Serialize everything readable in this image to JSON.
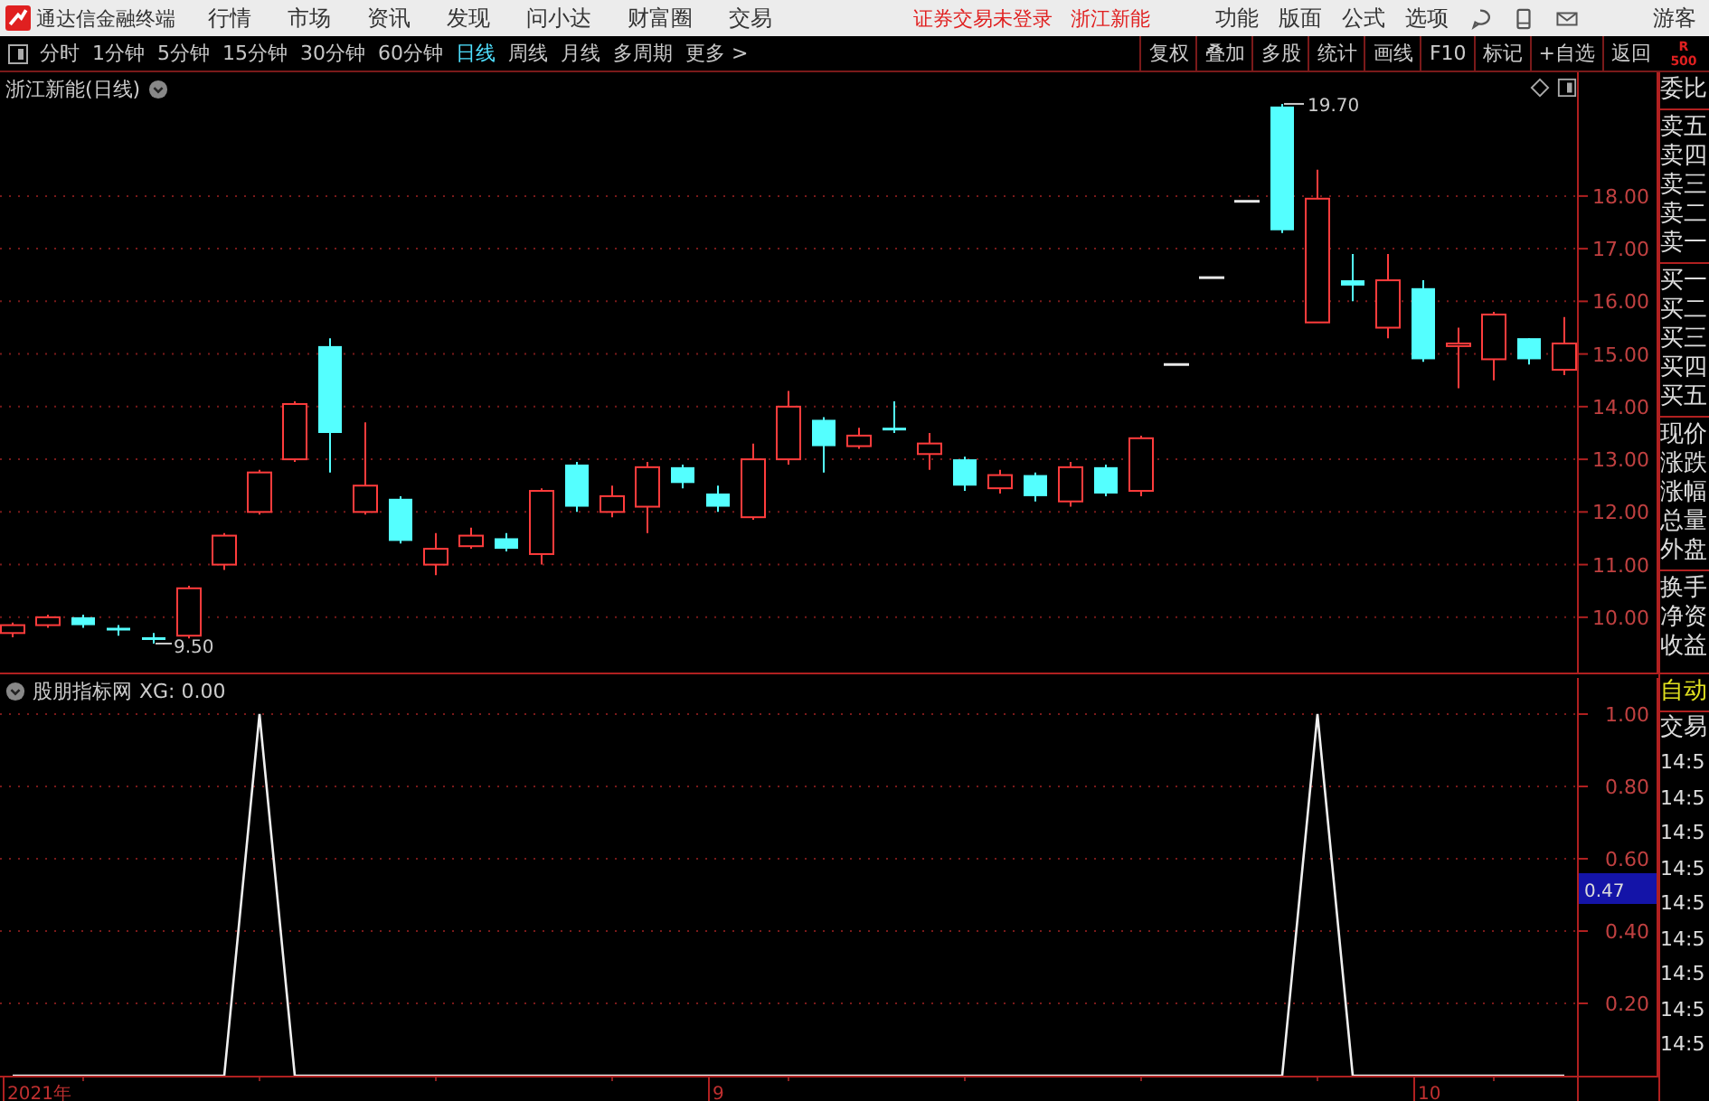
{
  "app": {
    "title": "通达信金融终端"
  },
  "menu": [
    "行情",
    "市场",
    "资讯",
    "发现",
    "问小达",
    "财富圈",
    "交易"
  ],
  "notices": [
    "证券交易未登录",
    "浙江新能"
  ],
  "tools": [
    "功能",
    "版面",
    "公式",
    "选项"
  ],
  "user": "游客",
  "periods": [
    {
      "label": "分时",
      "selected": false
    },
    {
      "label": "1分钟",
      "selected": false
    },
    {
      "label": "5分钟",
      "selected": false
    },
    {
      "label": "15分钟",
      "selected": false
    },
    {
      "label": "30分钟",
      "selected": false
    },
    {
      "label": "60分钟",
      "selected": false
    },
    {
      "label": "日线",
      "selected": true
    },
    {
      "label": "周线",
      "selected": false
    },
    {
      "label": "月线",
      "selected": false
    },
    {
      "label": "多周期",
      "selected": false
    }
  ],
  "more": "更多 >",
  "actions": [
    "复权",
    "叠加",
    "多股",
    "统计",
    "画线",
    "F10",
    "标记",
    "+自选",
    "返回"
  ],
  "level_badge": [
    "R",
    "500"
  ],
  "price_chart": {
    "title": "浙江新能(日线)",
    "high_label": "19.70",
    "low_label": "9.50",
    "chart_data": {
      "type": "candlestick",
      "ohlc": [
        [
          9.7,
          9.9,
          9.62,
          9.85
        ],
        [
          9.85,
          10.05,
          9.8,
          10.0
        ],
        [
          10.0,
          10.05,
          9.8,
          9.85
        ],
        [
          9.8,
          9.85,
          9.65,
          9.75
        ],
        [
          9.62,
          9.7,
          9.5,
          9.6
        ],
        [
          9.65,
          10.6,
          9.6,
          10.55
        ],
        [
          11.0,
          11.6,
          10.9,
          11.55
        ],
        [
          12.0,
          12.8,
          11.95,
          12.75
        ],
        [
          13.0,
          14.1,
          12.95,
          14.05
        ],
        [
          15.15,
          15.3,
          12.75,
          13.5
        ],
        [
          12.0,
          13.7,
          11.95,
          12.5
        ],
        [
          12.25,
          12.3,
          11.4,
          11.45
        ],
        [
          11.0,
          11.6,
          10.8,
          11.3
        ],
        [
          11.35,
          11.7,
          11.3,
          11.55
        ],
        [
          11.5,
          11.6,
          11.25,
          11.3
        ],
        [
          11.2,
          12.45,
          11.0,
          12.4
        ],
        [
          12.9,
          12.95,
          12.0,
          12.1
        ],
        [
          12.0,
          12.5,
          11.9,
          12.3
        ],
        [
          12.1,
          12.95,
          11.6,
          12.85
        ],
        [
          12.85,
          12.9,
          12.45,
          12.55
        ],
        [
          12.35,
          12.5,
          12.0,
          12.1
        ],
        [
          11.9,
          13.3,
          11.85,
          13.0
        ],
        [
          13.0,
          14.3,
          12.9,
          14.0
        ],
        [
          13.75,
          13.8,
          12.75,
          13.25
        ],
        [
          13.25,
          13.6,
          13.2,
          13.45
        ],
        [
          13.6,
          14.1,
          13.5,
          13.55
        ],
        [
          13.1,
          13.5,
          12.8,
          13.3
        ],
        [
          13.0,
          13.05,
          12.4,
          12.5
        ],
        [
          12.45,
          12.8,
          12.35,
          12.7
        ],
        [
          12.7,
          12.75,
          12.2,
          12.3
        ],
        [
          12.2,
          12.95,
          12.1,
          12.85
        ],
        [
          12.85,
          12.9,
          12.3,
          12.35
        ],
        [
          12.4,
          13.45,
          12.3,
          13.4
        ],
        [
          14.8,
          14.8,
          14.8,
          14.8
        ],
        [
          16.45,
          16.45,
          16.45,
          16.45
        ],
        [
          17.9,
          17.9,
          17.9,
          17.9
        ],
        [
          19.7,
          19.75,
          17.3,
          17.35
        ],
        [
          15.6,
          18.5,
          15.6,
          17.95
        ],
        [
          16.4,
          16.9,
          16.0,
          16.3
        ],
        [
          15.5,
          16.9,
          15.3,
          16.4
        ],
        [
          16.25,
          16.4,
          14.85,
          14.9
        ],
        [
          15.15,
          15.5,
          14.35,
          15.2
        ],
        [
          14.9,
          15.8,
          14.5,
          15.75
        ],
        [
          15.3,
          15.3,
          14.8,
          14.9
        ],
        [
          14.7,
          15.7,
          14.6,
          15.2
        ]
      ],
      "ylim": [
        8.95,
        20.35
      ],
      "grid": true,
      "yticks": [
        {
          "value": 18,
          "label": "18.00"
        },
        {
          "value": 17,
          "label": "17.00"
        },
        {
          "value": 16,
          "label": "16.00"
        },
        {
          "value": 15,
          "label": "15.00"
        },
        {
          "value": 14,
          "label": "14.00"
        },
        {
          "value": 13,
          "label": "13.00"
        },
        {
          "value": 12,
          "label": "12.00"
        },
        {
          "value": 11,
          "label": "11.00"
        },
        {
          "value": 10,
          "label": "10.00"
        }
      ]
    }
  },
  "indicator": {
    "name": "股朋指标网",
    "reading": "XG: 0.00",
    "cursor_value": "0.47",
    "chart_data": {
      "type": "line",
      "values": [
        0,
        0,
        0,
        0,
        0,
        0,
        0,
        1,
        0,
        0,
        0,
        0,
        0,
        0,
        0,
        0,
        0,
        0,
        0,
        0,
        0,
        0,
        0,
        0,
        0,
        0,
        0,
        0,
        0,
        0,
        0,
        0,
        0,
        0,
        0,
        0,
        0,
        1,
        0,
        0,
        0,
        0,
        0,
        0,
        0
      ],
      "ylim": [
        0,
        1.1
      ],
      "grid": true,
      "yticks": [
        {
          "value": 1,
          "label": "1.00"
        },
        {
          "value": 0.8,
          "label": "0.80"
        },
        {
          "value": 0.6,
          "label": "0.60"
        },
        {
          "value": 0.4,
          "label": "0.40"
        },
        {
          "value": 0.2,
          "label": "0.20"
        }
      ]
    }
  },
  "date_labels": [
    "2021年",
    "9",
    "10"
  ],
  "quote_sections": [
    {
      "labels": [
        "委比"
      ]
    },
    {
      "labels": [
        "卖五",
        "卖四",
        "卖三",
        "卖二",
        "卖一"
      ]
    },
    {
      "labels": [
        "买一",
        "买二",
        "买三",
        "买四",
        "买五"
      ]
    },
    {
      "labels": [
        "现价",
        "涨跌",
        "涨幅",
        "总量",
        "外盘"
      ]
    },
    {
      "labels": [
        "换手",
        "净资",
        "收益"
      ]
    }
  ],
  "trade_panel": {
    "mode": "自动",
    "title": "交易",
    "times": [
      "14:5",
      "14:5",
      "14:5",
      "14:5",
      "14:5",
      "14:5",
      "14:5",
      "14:5",
      "14:5"
    ]
  }
}
